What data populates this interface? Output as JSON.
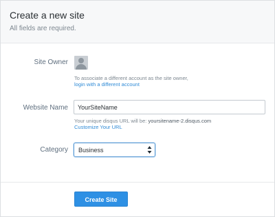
{
  "header": {
    "title": "Create a new site",
    "subtitle": "All fields are required."
  },
  "site_owner": {
    "label": "Site Owner",
    "avatar_icon": "user-avatar-placeholder",
    "help_text": "To associate a different account as the site owner,",
    "link_text": "login with a different account"
  },
  "website_name": {
    "label": "Website Name",
    "value": "YourSiteName",
    "help_prefix": "Your unique disqus URL will be: ",
    "help_url": "yoursitename-2.disqus.com",
    "customize_link": "Customize Your URL"
  },
  "category": {
    "label": "Category",
    "selected": "Business",
    "arrow_icon": "up-down-chevron-icon"
  },
  "footer": {
    "submit_label": "Create Site"
  },
  "colors": {
    "accent": "#2e90e4",
    "link": "#2e8ad6",
    "header_bg": "#f7f8f9"
  }
}
